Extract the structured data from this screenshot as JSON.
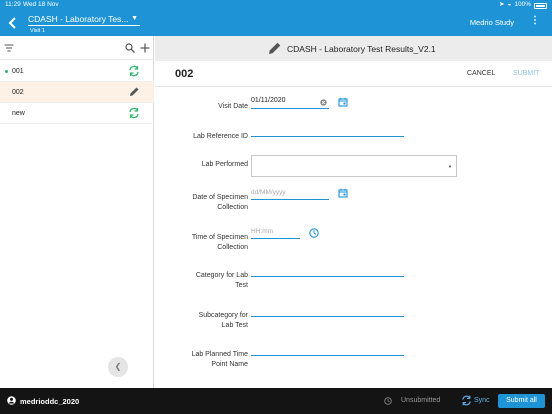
{
  "status_bar": {
    "time": "11:29",
    "date": "Wed 18 Nov",
    "battery": "100%"
  },
  "nav": {
    "form_title": "CDASH - Laboratory Tes...",
    "visit": "Visit 1",
    "study": "Medrio Study"
  },
  "subjects": [
    {
      "label": "001",
      "has_dot": true,
      "icon": "sync-icon"
    },
    {
      "label": "002",
      "has_dot": false,
      "icon": "pencil-icon",
      "selected": true
    },
    {
      "label": "new",
      "has_dot": false,
      "icon": "sync-icon"
    }
  ],
  "form": {
    "header_title": "CDASH - Laboratory Test Results_V2.1",
    "record_id": "002",
    "cancel_label": "CANCEL",
    "submit_label": "SUBMIT",
    "fields": {
      "visit_date": {
        "label": "Visit Date",
        "value": "01/11/2020"
      },
      "lab_reference_id": {
        "label": "Lab Reference ID"
      },
      "lab_performed": {
        "label": "Lab Performed"
      },
      "specimen_date": {
        "label_1": "Date of Specimen",
        "label_2": "Collection",
        "placeholder": "dd/MM/yyyy"
      },
      "specimen_time": {
        "label_1": "Time of Specimen",
        "label_2": "Collection",
        "placeholder": "HH:mm"
      },
      "category": {
        "label_1": "Category for Lab",
        "label_2": "Test"
      },
      "subcategory": {
        "label_1": "Subcategory for",
        "label_2": "Lab Test"
      },
      "planned_time": {
        "label_1": "Lab Planned Time",
        "label_2": "Point Name"
      }
    }
  },
  "bottom": {
    "user": "medrioddc_2020",
    "status": "Unsubmitted",
    "sync_label": "Sync",
    "submit_all_label": "Submit all"
  },
  "colors": {
    "accent": "#1e94d6",
    "success": "#33b36b",
    "dark": "#141414",
    "selected_row": "#fdf1e6"
  }
}
